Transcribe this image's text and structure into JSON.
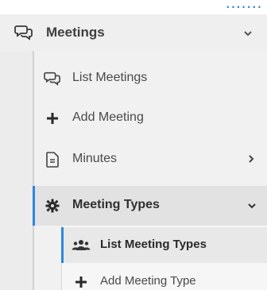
{
  "menu": {
    "meetings": {
      "label": "Meetings",
      "icon": "chat-bubbles-icon"
    },
    "items": [
      {
        "label": "List Meetings",
        "icon": "chat-bubbles-icon"
      },
      {
        "label": "Add Meeting",
        "icon": "plus-icon"
      },
      {
        "label": "Minutes",
        "icon": "document-icon"
      }
    ],
    "meeting_types": {
      "label": "Meeting Types",
      "icon": "gear-icon",
      "items": [
        {
          "label": "List Meeting Types",
          "icon": "users-icon"
        },
        {
          "label": "Add Meeting Type",
          "icon": "plus-icon"
        }
      ]
    }
  },
  "colors": {
    "accent": "#2e86de",
    "menu_bg": "#ececec",
    "active_bg": "#e2e2e2"
  }
}
